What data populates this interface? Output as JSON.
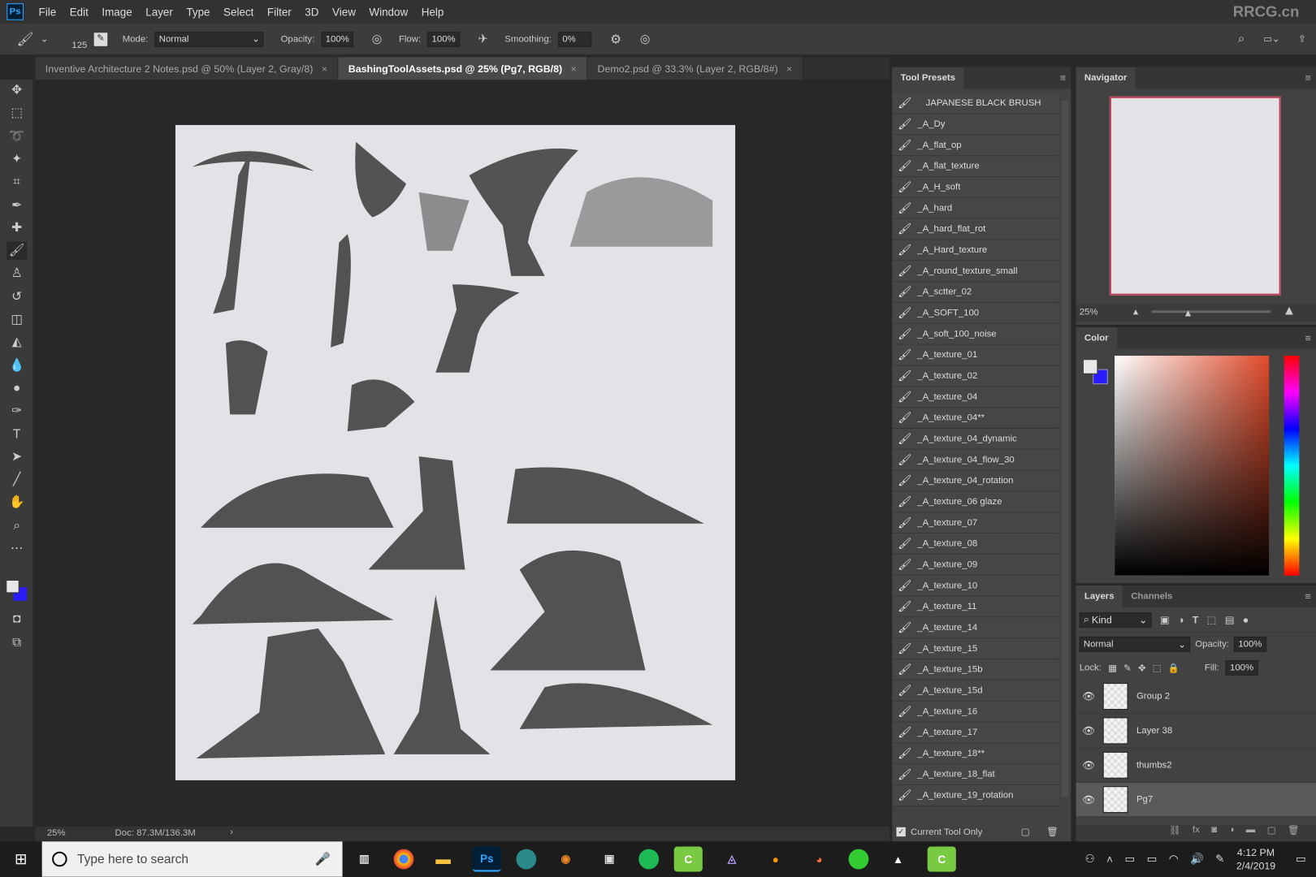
{
  "app": {
    "logo": "Ps",
    "menu": [
      "File",
      "Edit",
      "Image",
      "Layer",
      "Type",
      "Select",
      "Filter",
      "3D",
      "View",
      "Window",
      "Help"
    ],
    "watermark": "RRCG.cn"
  },
  "options": {
    "brush_size": "125",
    "mode_label": "Mode:",
    "mode": "Normal",
    "opacity_label": "Opacity:",
    "opacity": "100%",
    "flow_label": "Flow:",
    "flow": "100%",
    "smoothing_label": "Smoothing:",
    "smoothing": "0%"
  },
  "tabs": [
    {
      "label": "Inventive Architecture 2 Notes.psd @ 50% (Layer 2, Gray/8)",
      "active": false
    },
    {
      "label": "BashingToolAssets.psd @ 25% (Pg7, RGB/8)",
      "active": true
    },
    {
      "label": "Demo2.psd @ 33.3% (Layer 2, RGB/8#)",
      "active": false
    }
  ],
  "status": {
    "zoom": "25%",
    "doc": "Doc: 87.3M/136.3M"
  },
  "tool_presets": {
    "title": "Tool Presets",
    "items": [
      "JAPANESE BLACK BRUSH",
      "_A_Dy",
      "_A_flat_op",
      "_A_flat_texture",
      "_A_H_soft",
      "_A_hard",
      "_A_hard_flat_rot",
      "_A_Hard_texture",
      "_A_round_texture_small",
      "_A_sctter_02",
      "_A_SOFT_100",
      "_A_soft_100_noise",
      "_A_texture_01",
      "_A_texture_02",
      "_A_texture_04",
      "_A_texture_04**",
      "_A_texture_04_dynamic",
      "_A_texture_04_flow_30",
      "_A_texture_04_rotation",
      "_A_texture_06 glaze",
      "_A_texture_07",
      "_A_texture_08",
      "_A_texture_09",
      "_A_texture_10",
      "_A_texture_11",
      "_A_texture_14",
      "_A_texture_15",
      "_A_texture_15b",
      "_A_texture_15d",
      "_A_texture_16",
      "_A_texture_17",
      "_A_texture_18**",
      "_A_texture_18_flat",
      "_A_texture_19_rotation"
    ],
    "current_tool_only": "Current Tool Only",
    "current_tool_only_checked": true
  },
  "navigator": {
    "title": "Navigator",
    "zoom": "25%",
    "zoom_slider_percent": 30
  },
  "color": {
    "title": "Color",
    "foreground": "#e8e8e8",
    "background": "#2a1cff",
    "hue": "#e04a2a"
  },
  "layers": {
    "tabs": [
      "Layers",
      "Channels"
    ],
    "filter": "Kind",
    "blend": "Normal",
    "opacity_label": "Opacity:",
    "opacity": "100%",
    "lock_label": "Lock:",
    "fill_label": "Fill:",
    "fill": "100%",
    "items": [
      {
        "name": "Group 2",
        "selected": false
      },
      {
        "name": "Layer 38",
        "selected": false
      },
      {
        "name": "thumbs2",
        "selected": false
      },
      {
        "name": "Pg7",
        "selected": true
      }
    ]
  },
  "taskbar": {
    "search_placeholder": "Type here to search",
    "time": "4:12 PM",
    "date": "2/4/2019"
  }
}
